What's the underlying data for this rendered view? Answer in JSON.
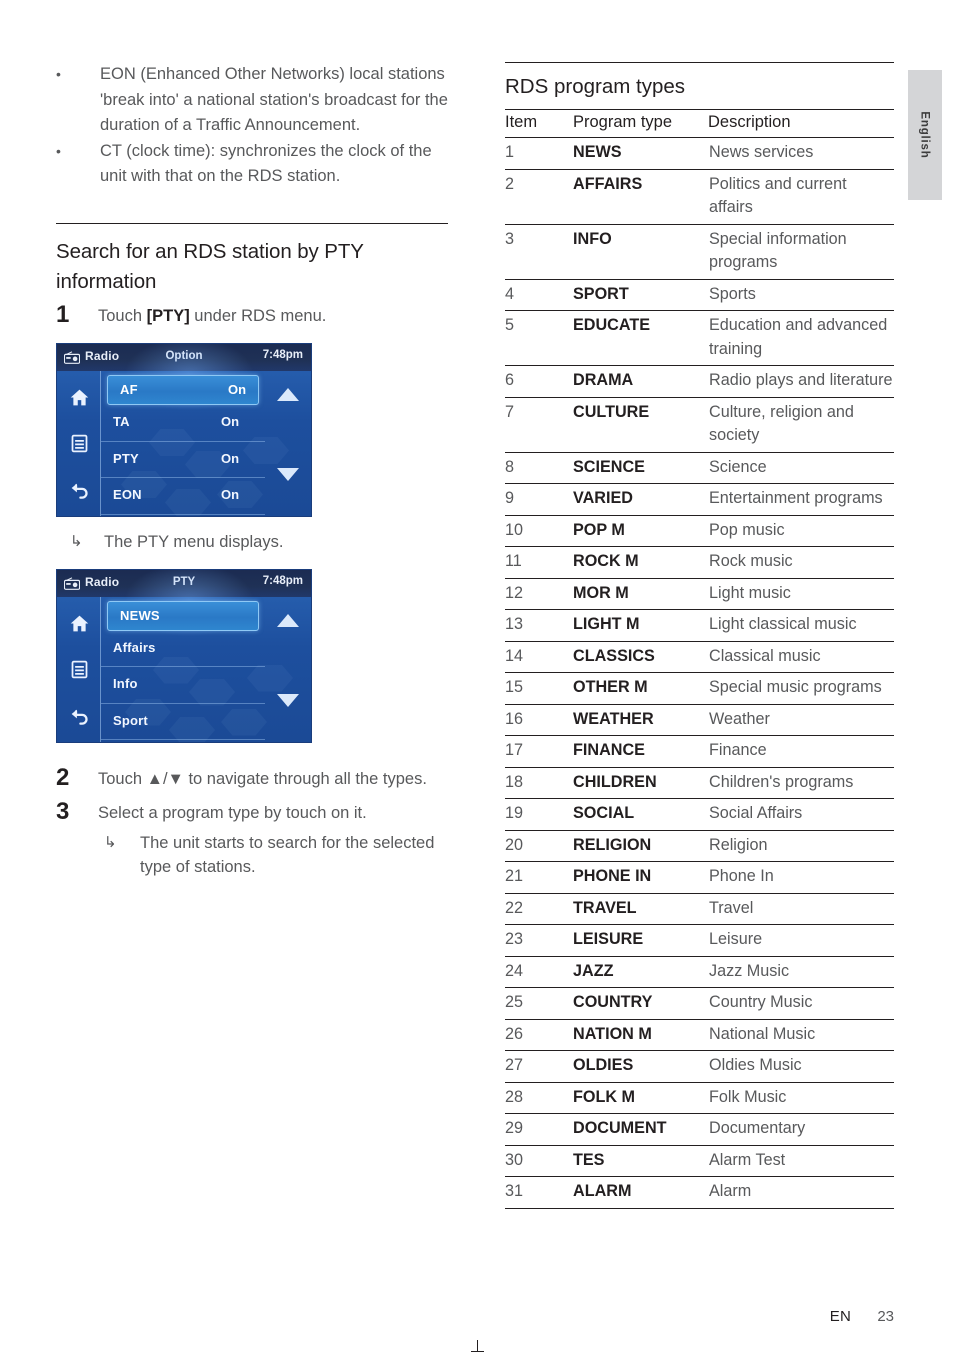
{
  "sidebar_tab": {
    "label": "English"
  },
  "left_column": {
    "bullets": [
      "EON (Enhanced Other Networks) local stations 'break into' a national station's broadcast for the duration of a Traffic Announcement.",
      "CT (clock time): synchronizes the clock of the unit with that on the RDS station."
    ],
    "section_title": "Search for an RDS station by PTY information",
    "steps": [
      {
        "num": "1",
        "text_before": "Touch ",
        "bold": "[PTY]",
        "text_after": " under RDS menu."
      },
      {
        "num": "2",
        "text": "Touch ▲/▼ to navigate through all the types."
      },
      {
        "num": "3",
        "text": "Select a program type by touch on it."
      }
    ],
    "note_after_step1": "The PTY menu displays.",
    "note_after_step3": "The unit starts to search for the selected type of stations.",
    "arrow_glyph": "↳"
  },
  "device_option": {
    "source_label": "Radio",
    "title": "Option",
    "clock": "7:48pm",
    "icons": [
      "home-icon",
      "list-icon",
      "back-icon"
    ],
    "rows": [
      {
        "label": "AF",
        "value": "On",
        "selected": true
      },
      {
        "label": "TA",
        "value": "On",
        "selected": false
      },
      {
        "label": "PTY",
        "value": "On",
        "selected": false
      },
      {
        "label": "EON",
        "value": "On",
        "selected": false
      }
    ],
    "scroll_up": "▲",
    "scroll_down": "▼"
  },
  "device_pty": {
    "source_label": "Radio",
    "title": "PTY",
    "clock": "7:48pm",
    "icons": [
      "home-icon",
      "list-icon",
      "back-icon"
    ],
    "rows": [
      {
        "label": "NEWS",
        "value": "",
        "selected": true
      },
      {
        "label": "Affairs",
        "value": "",
        "selected": false
      },
      {
        "label": "Info",
        "value": "",
        "selected": false
      },
      {
        "label": "Sport",
        "value": "",
        "selected": false
      }
    ],
    "scroll_up": "▲",
    "scroll_down": "▼"
  },
  "right_column": {
    "title": "RDS program types",
    "table": {
      "headers": [
        "Item",
        "Program type",
        "Description"
      ],
      "rows": [
        {
          "item": "1",
          "type": "NEWS",
          "desc": "News services",
          "thick": false
        },
        {
          "item": "2",
          "type": "AFFAIRS",
          "desc": "Politics and current affairs",
          "thick": false
        },
        {
          "item": "3",
          "type": "INFO",
          "desc": "Special information programs",
          "thick": false
        },
        {
          "item": "4",
          "type": "SPORT",
          "desc": "Sports",
          "thick": true
        },
        {
          "item": "5",
          "type": "EDUCATE",
          "desc": "Education and advanced training",
          "thick": false
        },
        {
          "item": "6",
          "type": "DRAMA",
          "desc": "Radio plays and literature",
          "thick": false
        },
        {
          "item": "7",
          "type": "CULTURE",
          "desc": "Culture, religion and society",
          "thick": false
        },
        {
          "item": "8",
          "type": "SCIENCE",
          "desc": "Science",
          "thick": true
        },
        {
          "item": "9",
          "type": "VARIED",
          "desc": "Entertainment programs",
          "thick": false
        },
        {
          "item": "10",
          "type": "POP M",
          "desc": "Pop music",
          "thick": false
        },
        {
          "item": "11",
          "type": "ROCK M",
          "desc": "Rock music",
          "thick": false
        },
        {
          "item": "12",
          "type": "MOR M",
          "desc": "Light music",
          "thick": false
        },
        {
          "item": "13",
          "type": "LIGHT M",
          "desc": "Light classical music",
          "thick": false
        },
        {
          "item": "14",
          "type": "CLASSICS",
          "desc": "Classical music",
          "thick": false
        },
        {
          "item": "15",
          "type": "OTHER M",
          "desc": "Special music programs",
          "thick": false
        },
        {
          "item": "16",
          "type": "WEATHER",
          "desc": "Weather",
          "thick": false
        },
        {
          "item": "17",
          "type": "FINANCE",
          "desc": "Finance",
          "thick": false
        },
        {
          "item": "18",
          "type": "CHILDREN",
          "desc": "Children's programs",
          "thick": false
        },
        {
          "item": "19",
          "type": "SOCIAL",
          "desc": "Social Affairs",
          "thick": false
        },
        {
          "item": "20",
          "type": "RELIGION",
          "desc": "Religion",
          "thick": false
        },
        {
          "item": "21",
          "type": "PHONE IN",
          "desc": "Phone In",
          "thick": false
        },
        {
          "item": "22",
          "type": "TRAVEL",
          "desc": "Travel",
          "thick": false
        },
        {
          "item": "23",
          "type": "LEISURE",
          "desc": "Leisure",
          "thick": false
        },
        {
          "item": "24",
          "type": "JAZZ",
          "desc": "Jazz Music",
          "thick": false
        },
        {
          "item": "25",
          "type": "COUNTRY",
          "desc": "Country Music",
          "thick": true
        },
        {
          "item": "26",
          "type": "NATION M",
          "desc": "National Music",
          "thick": false
        },
        {
          "item": "27",
          "type": "OLDIES",
          "desc": "Oldies Music",
          "thick": false
        },
        {
          "item": "28",
          "type": "FOLK M",
          "desc": "Folk Music",
          "thick": false
        },
        {
          "item": "29",
          "type": "DOCUMENT",
          "desc": "Documentary",
          "thick": true
        },
        {
          "item": "30",
          "type": "TES",
          "desc": "Alarm Test",
          "thick": false
        },
        {
          "item": "31",
          "type": "ALARM",
          "desc": "Alarm",
          "thick": false
        }
      ]
    }
  },
  "footer": {
    "language_code": "EN",
    "page_number": "23"
  }
}
